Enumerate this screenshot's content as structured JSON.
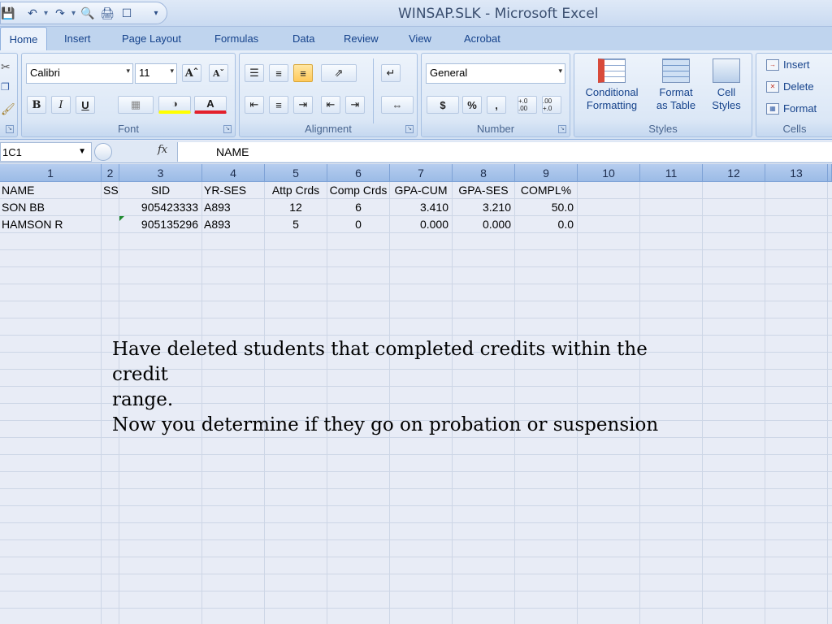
{
  "window": {
    "title": "WINSAP.SLK - Microsoft Excel"
  },
  "ribbon": {
    "tabs": [
      "Home",
      "Insert",
      "Page Layout",
      "Formulas",
      "Data",
      "Review",
      "View",
      "Acrobat"
    ],
    "font": {
      "name": "Calibri",
      "size": "11",
      "group_label": "Font"
    },
    "alignment": {
      "group_label": "Alignment"
    },
    "number": {
      "format": "General",
      "group_label": "Number",
      "currency": "$",
      "percent": "%",
      "comma": ",",
      "inc_decimal": "+.0 .00",
      "dec_decimal": ".00 +.0"
    },
    "styles": {
      "group_label": "Styles",
      "conditional": [
        "Conditional",
        "Formatting"
      ],
      "format_table": [
        "Format",
        "as Table"
      ],
      "cell_styles": [
        "Cell",
        "Styles"
      ]
    },
    "cells": {
      "group_label": "Cells",
      "insert": "Insert",
      "delete": "Delete",
      "format": "Format"
    }
  },
  "formula_bar": {
    "name_box": "1C1",
    "fx": "fx",
    "content": "NAME"
  },
  "columns": [
    "1",
    "2",
    "3",
    "4",
    "5",
    "6",
    "7",
    "8",
    "9",
    "10",
    "11",
    "12",
    "13"
  ],
  "headers": [
    "NAME",
    "SSI",
    "SID",
    "YR-SES",
    "Attp Crds",
    "Comp Crds",
    "GPA-CUM",
    "GPA-SES",
    "COMPL%"
  ],
  "rows": [
    [
      "SON BB",
      "",
      "905423333",
      "A893",
      "12",
      "6",
      "3.410",
      "3.210",
      "50.0"
    ],
    [
      "HAMSON R",
      "",
      "905135296",
      "A893",
      "5",
      "0",
      "0.000",
      "0.000",
      "0.0"
    ]
  ],
  "note": {
    "line1": "Have deleted students that completed credits within the credit",
    "line2": "range.",
    "line3": "Now you determine if they go on probation or suspension"
  }
}
